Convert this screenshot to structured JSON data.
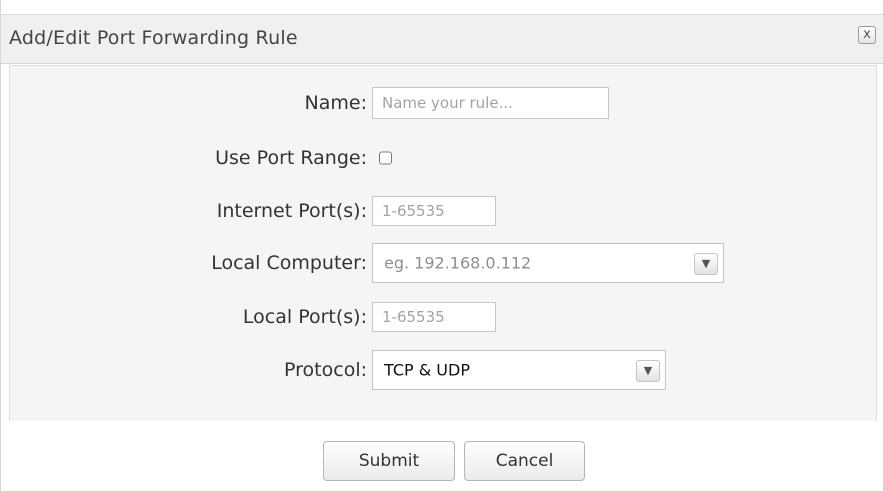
{
  "dialog": {
    "title": "Add/Edit Port Forwarding Rule",
    "close_glyph": "x",
    "close_icon": "close-icon"
  },
  "form": {
    "name": {
      "label": "Name:",
      "value": "",
      "placeholder": "Name your rule..."
    },
    "use_port_range": {
      "label": "Use Port Range:",
      "checked": false
    },
    "internet_ports": {
      "label": "Internet Port(s):",
      "value": "",
      "placeholder": "1-65535"
    },
    "local_computer": {
      "label": "Local Computer:",
      "value": "",
      "placeholder": "eg. 192.168.0.112",
      "icon": "chevron-down-icon",
      "arrow_glyph": "▼"
    },
    "local_ports": {
      "label": "Local Port(s):",
      "value": "",
      "placeholder": "1-65535"
    },
    "protocol": {
      "label": "Protocol:",
      "selected": "TCP & UDP",
      "icon": "chevron-down-icon",
      "arrow_glyph": "▼"
    }
  },
  "buttons": {
    "submit": "Submit",
    "cancel": "Cancel"
  }
}
